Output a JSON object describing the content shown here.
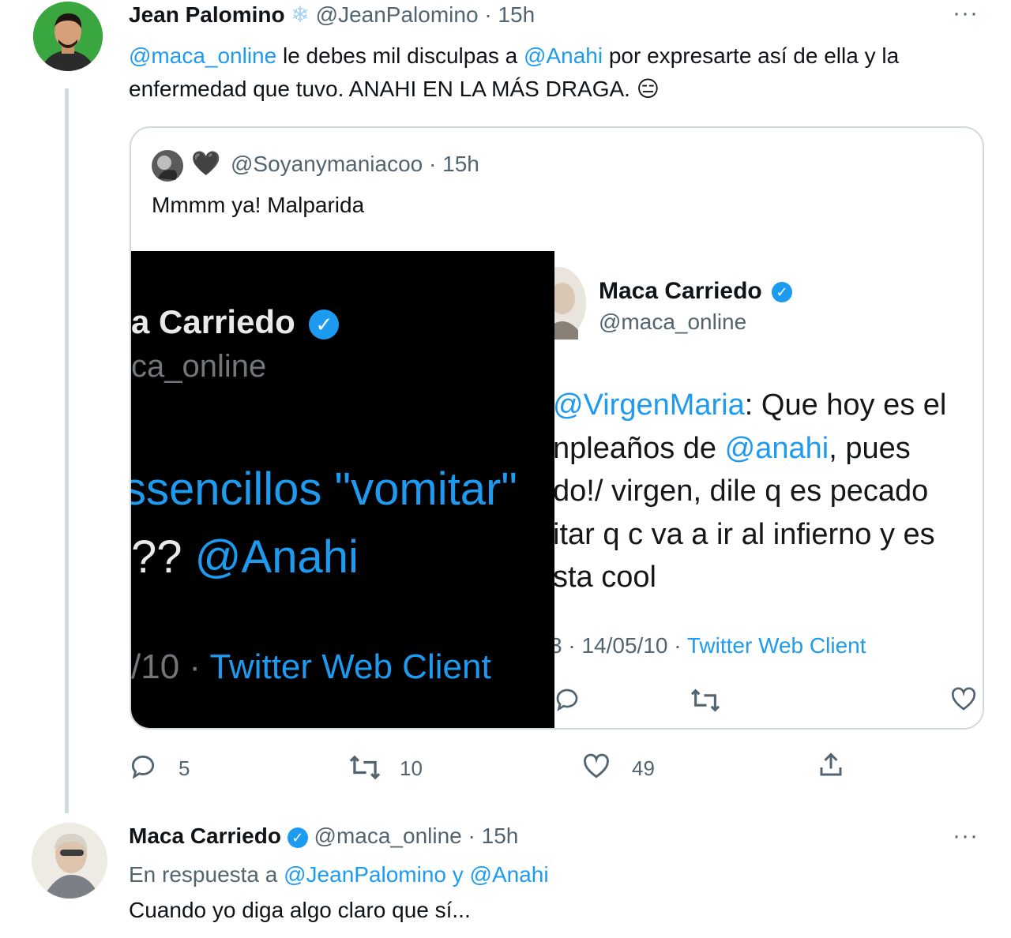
{
  "tweet1": {
    "display_name": "Jean Palomino",
    "name_emoji": "❄",
    "handle": "@JeanPalomino",
    "separator": "·",
    "time": "15h",
    "more": "···",
    "text": {
      "mention1": "@maca_online",
      "part1": " le debes mil disculpas a ",
      "mention2": "@Anahi",
      "part2": " por expresarte así de ella y la enfermedad que tuvo. ANAHI EN LA MÁS DRAGA. ",
      "emoji": "😑"
    },
    "actions": {
      "reply_count": "5",
      "retweet_count": "10",
      "like_count": "49"
    }
  },
  "quoted": {
    "name_emoji": "🖤",
    "handle": "@Soyanymaniacoo",
    "separator": "·",
    "time": "15h",
    "text": "Mmmm ya! Malparida",
    "dark_image": {
      "name": "a Carriedo",
      "handle": "ca_online",
      "line1": "ssencillos \"vomitar\"",
      "line2_prefix": "?? ",
      "line2_mention": "@Anahi",
      "footer_date": "/10 · ",
      "footer_client": "Twitter Web Client"
    },
    "light_image": {
      "name": "Maca Carriedo",
      "handle": "@maca_online",
      "line1_mention": "@VirgenMaria",
      "line1_rest": ": Que hoy es el",
      "line2_prefix": "npleaños de ",
      "line2_mention": "@anahi",
      "line2_rest": ", pues",
      "line3": "do!/ virgen, dile q es pecado",
      "line4": "itar q c va a ir al infierno y es",
      "line5": "sta cool",
      "footer_date": "3 · 14/05/10 · ",
      "footer_client": "Twitter Web Client"
    }
  },
  "tweet2": {
    "display_name": "Maca Carriedo",
    "handle": "@maca_online",
    "separator": "·",
    "time": "15h",
    "more": "···",
    "reply_prefix": "En respuesta a ",
    "reply_mentions": "@JeanPalomino y @Anahi",
    "text": "Cuando yo diga algo claro que sí..."
  },
  "colors": {
    "link": "#1d9bf0",
    "muted": "#536471",
    "text": "#0f1419",
    "border": "#cfd9de"
  }
}
